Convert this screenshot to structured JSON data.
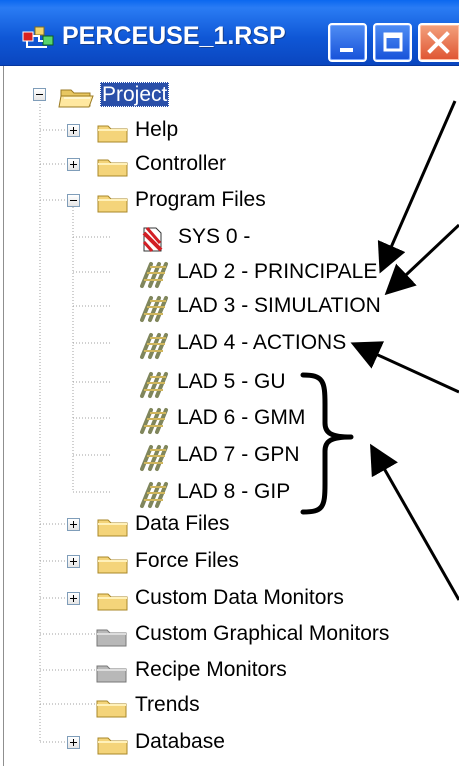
{
  "window": {
    "title": "PERCEUSE_1.RSP",
    "title_icon": "project-tree-icon",
    "controls": {
      "minimize": "minimize-icon",
      "maximize": "maximize-icon",
      "close": "close-icon"
    }
  },
  "tree": {
    "root": {
      "label": "Project",
      "icon": "open-folder-icon",
      "expanded": true,
      "selected": true
    },
    "items": {
      "help": {
        "label": "Help",
        "icon": "folder-icon",
        "expander": "plus"
      },
      "controller": {
        "label": "Controller",
        "icon": "folder-icon",
        "expander": "plus"
      },
      "program_files": {
        "label": "Program Files",
        "icon": "folder-icon",
        "expander": "minus",
        "children": {
          "sys0": {
            "label": "SYS 0 -",
            "icon": "system-file-icon"
          },
          "lad2": {
            "label": "LAD 2 - PRINCIPALE",
            "icon": "ladder-file-icon"
          },
          "lad3": {
            "label": "LAD 3 - SIMULATION",
            "icon": "ladder-file-icon"
          },
          "lad4": {
            "label": "LAD 4 - ACTIONS",
            "icon": "ladder-file-icon"
          },
          "lad5": {
            "label": "LAD 5 - GU",
            "icon": "ladder-file-icon"
          },
          "lad6": {
            "label": "LAD 6 - GMM",
            "icon": "ladder-file-icon"
          },
          "lad7": {
            "label": "LAD 7 - GPN",
            "icon": "ladder-file-icon"
          },
          "lad8": {
            "label": "LAD 8 - GIP",
            "icon": "ladder-file-icon"
          }
        }
      },
      "data_files": {
        "label": "Data Files",
        "icon": "folder-icon",
        "expander": "plus"
      },
      "force_files": {
        "label": "Force Files",
        "icon": "folder-icon",
        "expander": "plus"
      },
      "custom_data_monitors": {
        "label": "Custom Data Monitors",
        "icon": "folder-icon",
        "expander": "plus"
      },
      "custom_graphical_monitors": {
        "label": "Custom Graphical Monitors",
        "icon": "gray-folder-icon"
      },
      "recipe_monitors": {
        "label": "Recipe Monitors",
        "icon": "gray-folder-icon"
      },
      "trends": {
        "label": "Trends",
        "icon": "folder-icon"
      },
      "database": {
        "label": "Database",
        "icon": "folder-icon",
        "expander": "plus"
      }
    }
  },
  "annotation": {
    "arrow_color": "#000000",
    "selection_color": "#2a4fa9",
    "folder_color": "#f4d47a",
    "gray_folder_color": "#b8b8b8"
  }
}
